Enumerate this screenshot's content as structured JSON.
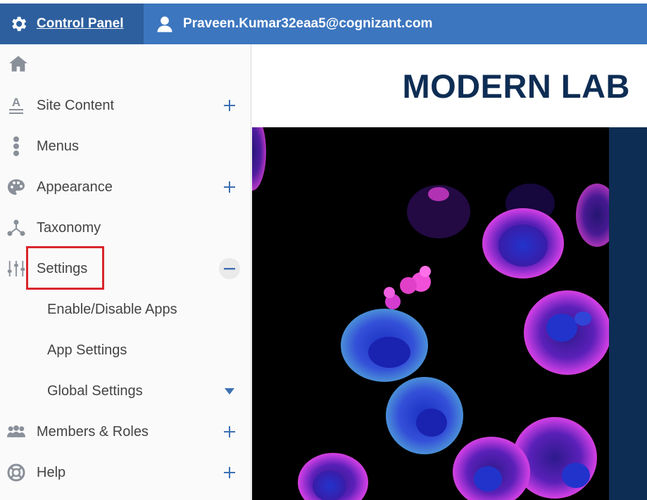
{
  "topbar": {
    "control_panel_label": "Control Panel",
    "gear_icon": "gear-icon",
    "user_icon": "user-icon",
    "user_email": "Praveen.Kumar32eaa5@cognizant.com",
    "bar_color": "#3c76bf",
    "panel_color": "#2d5f9e"
  },
  "sidebar": {
    "home_icon": "home-icon",
    "items": [
      {
        "label": "Site Content",
        "icon": "site-content-icon",
        "expander": "plus"
      },
      {
        "label": "Menus",
        "icon": "menus-icon"
      },
      {
        "label": "Appearance",
        "icon": "palette-icon",
        "expander": "plus"
      },
      {
        "label": "Taxonomy",
        "icon": "taxonomy-icon"
      },
      {
        "label": "Settings",
        "icon": "sliders-icon",
        "expander": "minus",
        "highlighted": true
      },
      {
        "label": "Members & Roles",
        "icon": "members-icon",
        "expander": "plus"
      },
      {
        "label": "Help",
        "icon": "help-icon",
        "expander": "plus"
      }
    ],
    "settings_subitems": [
      {
        "label": "Enable/Disable Apps"
      },
      {
        "label": "App Settings"
      },
      {
        "label": "Global Settings",
        "expander": "caret-down"
      }
    ],
    "highlight_color": "#d9262c",
    "accent_color": "#3c6fb3"
  },
  "main": {
    "site_title": "MODERN LAB",
    "title_color": "#0e2d54"
  }
}
